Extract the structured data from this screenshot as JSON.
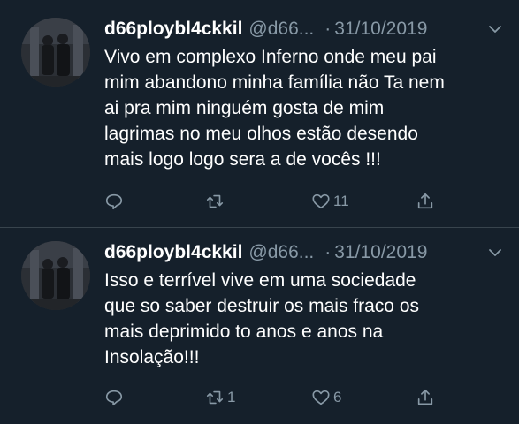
{
  "tweets": [
    {
      "display_name": "d66ploybl4ckkil",
      "handle": "@d66...",
      "separator": "·",
      "date": "31/10/2019",
      "text": "Vivo em complexo Inferno onde meu pai\nmim abandono minha família não Ta nem\nai pra mim ninguém gosta de mim\nlagrimas no meu olhos estão desendo\nmais logo logo sera a de vocês !!!",
      "retweet_count": "",
      "like_count": "11"
    },
    {
      "display_name": "d66ploybl4ckkil",
      "handle": "@d66...",
      "separator": "·",
      "date": "31/10/2019",
      "text": "Isso e terrível vive em uma sociedade\nque so saber destruir os mais fraco os\nmais deprimido to anos e anos na\nInsolação!!!",
      "retweet_count": "1",
      "like_count": "6"
    }
  ],
  "icons": {
    "reply": "reply-icon",
    "retweet": "retweet-icon",
    "like": "heart-icon",
    "share": "share-icon",
    "menu": "chevron-down-icon"
  },
  "colors": {
    "background": "#15202b",
    "text": "#ffffff",
    "secondary": "#8899a6",
    "divider": "#38444d"
  }
}
